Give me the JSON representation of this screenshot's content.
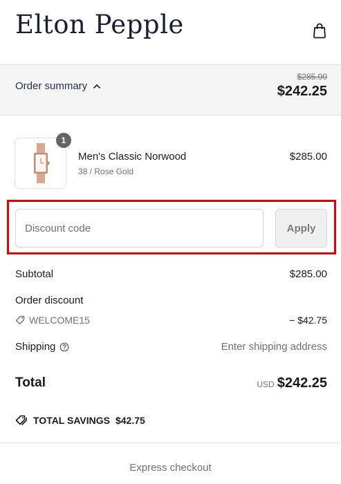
{
  "header": {
    "logo": "Elton Pepple",
    "bag_icon": "shopping-bag-icon"
  },
  "summary": {
    "toggle_label": "Order summary",
    "toggle_icon": "chevron-up-icon",
    "original_price": "$285.00",
    "current_price": "$242.25"
  },
  "product": {
    "quantity": "1",
    "name": "Men's Classic Norwood",
    "variant": "38 / Rose Gold",
    "price": "$285.00",
    "image_icon": "rose-gold-watch-image"
  },
  "discount": {
    "placeholder": "Discount code",
    "apply_label": "Apply"
  },
  "totals": {
    "subtotal_label": "Subtotal",
    "subtotal_value": "$285.00",
    "order_discount_label": "Order discount",
    "discount_code": "WELCOME15",
    "discount_value": "− $42.75",
    "shipping_label": "Shipping",
    "shipping_value": "Enter shipping address",
    "total_label": "Total",
    "currency": "USD",
    "total_value": "$242.25",
    "savings_label": "TOTAL SAVINGS",
    "savings_value": "$42.75"
  },
  "express": {
    "label": "Express checkout"
  },
  "colors": {
    "highlight_box": "#e00000",
    "summary_bg": "#f5f5f5",
    "logo": "#1a1f33"
  }
}
